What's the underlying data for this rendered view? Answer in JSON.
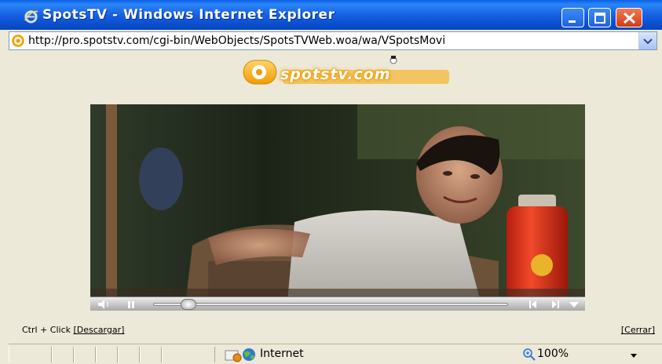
{
  "window": {
    "title": "SpotsTV - Windows Internet Explorer",
    "buttons": {
      "minimize": "minimize-icon",
      "maximize": "maximize-icon",
      "close": "close-icon"
    }
  },
  "address": {
    "url": "http://pro.spotstv.com/cgi-bin/WebObjects/SpotsTVWeb.woa/wa/VSpotsMovi"
  },
  "page": {
    "logo_text": "spotstv.com",
    "footer": {
      "ctrl_label": "Ctrl + Click",
      "download_link": "[Descargar]",
      "close_link": "[Cerrar]"
    }
  },
  "player": {
    "progress": 0.08
  },
  "status": {
    "zone": "Internet",
    "zoom": "100%"
  },
  "colors": {
    "titlebar": "#0a5fe8",
    "close_button": "#e04a22",
    "chrome_bg": "#ECE9D8",
    "logo_glow": "#f4a000"
  }
}
